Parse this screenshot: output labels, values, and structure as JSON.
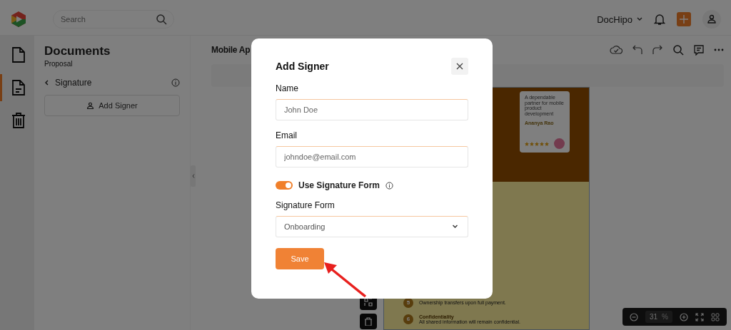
{
  "app_bar": {
    "search": {
      "placeholder": "Search"
    },
    "workspace": "DocHipo"
  },
  "rail": [
    {
      "kind": "document",
      "selected": false
    },
    {
      "kind": "document-lines",
      "selected": true
    },
    {
      "kind": "trash",
      "selected": false
    }
  ],
  "panel": {
    "title": "Documents",
    "subtitle": "Proposal",
    "section": "Signature",
    "add_button": "Add Signer"
  },
  "editor": {
    "title": "Mobile Ap",
    "zoom": {
      "value": "31",
      "unit": "%"
    }
  },
  "preview": {
    "quote": "A dependable partner for mobile product development",
    "author": "Ananya Rao",
    "stars": 5,
    "items": [
      {
        "number": "5",
        "description": "Ownership transfers upon full payment."
      },
      {
        "number": "6",
        "title": "Confidentiality",
        "description": "All shared information will remain confidential."
      }
    ]
  },
  "dialog": {
    "title": "Add Signer",
    "fields": [
      {
        "label": "Name",
        "placeholder": "John Doe"
      },
      {
        "label": "Email",
        "placeholder": "johndoe@email.com"
      }
    ],
    "toggle": {
      "label": "Use Signature Form",
      "on": true
    },
    "select": {
      "label": "Signature Form",
      "value": "Onboarding"
    },
    "save": "Save"
  }
}
